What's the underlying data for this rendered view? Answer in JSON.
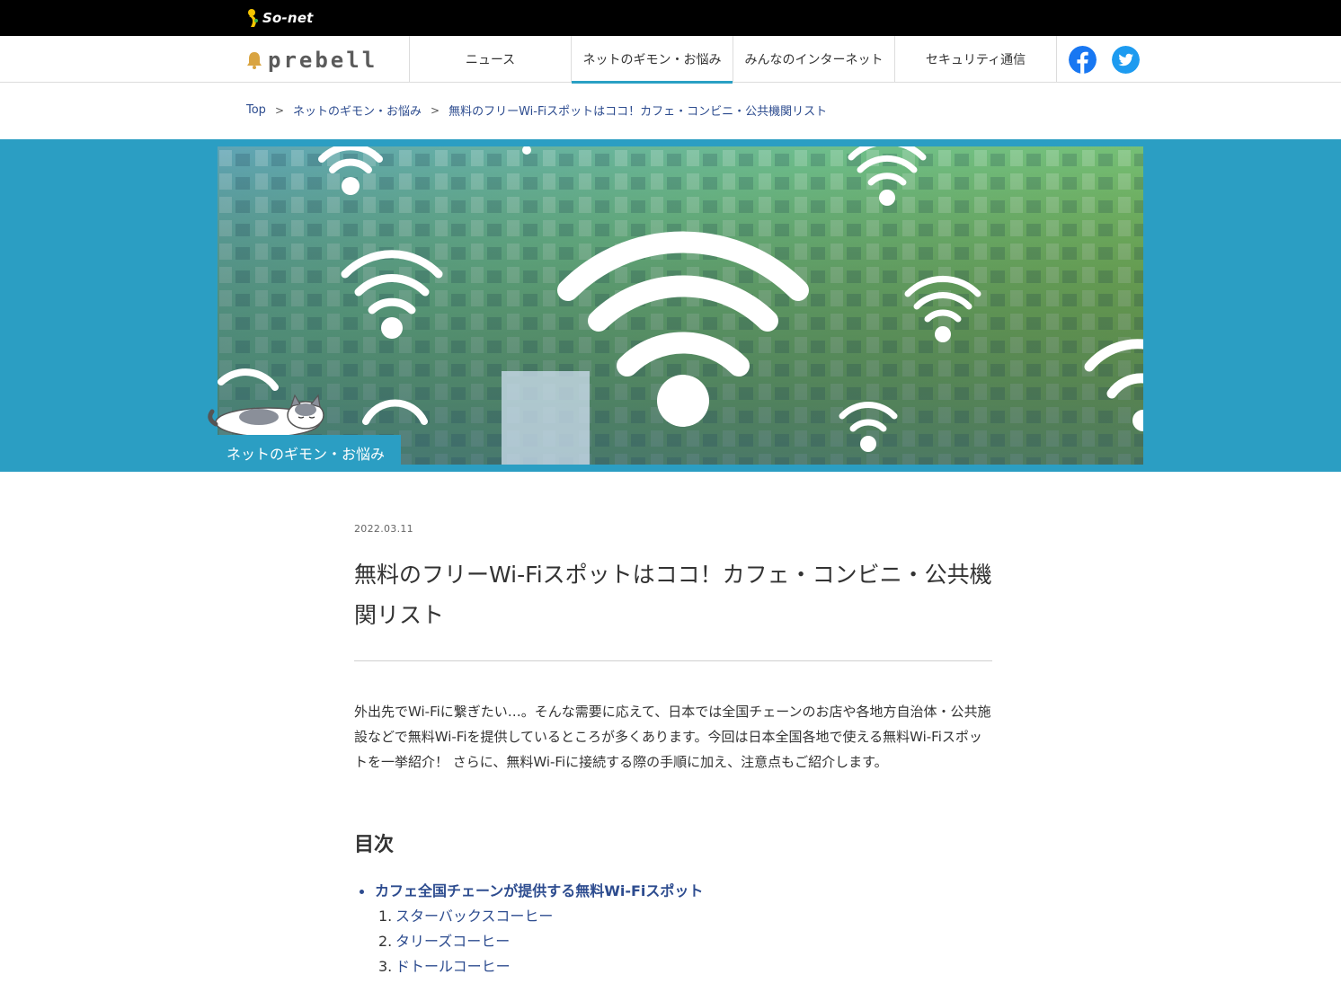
{
  "topbar": {
    "brand": "So-net"
  },
  "header": {
    "logo": "prebell",
    "nav": [
      {
        "label": "ニュース",
        "active": false
      },
      {
        "label": "ネットのギモン・お悩み",
        "active": true
      },
      {
        "label": "みんなのインターネット",
        "active": false
      },
      {
        "label": "セキュリティ通信",
        "active": false
      }
    ],
    "social": [
      "facebook-icon",
      "twitter-icon"
    ]
  },
  "breadcrumb": {
    "items": [
      "Top",
      "ネットのギモン・お悩み",
      "無料のフリーWi-Fiスポットはココ！カフェ・コンビニ・公共機関リスト"
    ],
    "separator": ">"
  },
  "hero": {
    "category": "ネットのギモン・お悩み"
  },
  "article": {
    "date": "2022.03.11",
    "title": "無料のフリーWi-Fiスポットはココ！カフェ・コンビニ・公共機関リスト",
    "lead": "外出先でWi-Fiに繋ぎたい…。そんな需要に応えて、日本では全国チェーンのお店や各地方自治体・公共施設などで無料Wi-Fiを提供しているところが多くあります。今回は日本全国各地で使える無料Wi-Fiスポットを一挙紹介！ さらに、無料Wi-Fiに接続する際の手順に加え、注意点もご紹介します。"
  },
  "toc": {
    "title": "目次",
    "section": "カフェ全国チェーンが提供する無料Wi-Fiスポット",
    "items": [
      {
        "num": "1.",
        "label": "スターバックスコーヒー"
      },
      {
        "num": "2.",
        "label": "タリーズコーヒー"
      },
      {
        "num": "3.",
        "label": "ドトールコーヒー"
      }
    ]
  },
  "colors": {
    "accent": "#2b9ec3",
    "link": "#2d4c8f",
    "topbar": "#000000"
  }
}
